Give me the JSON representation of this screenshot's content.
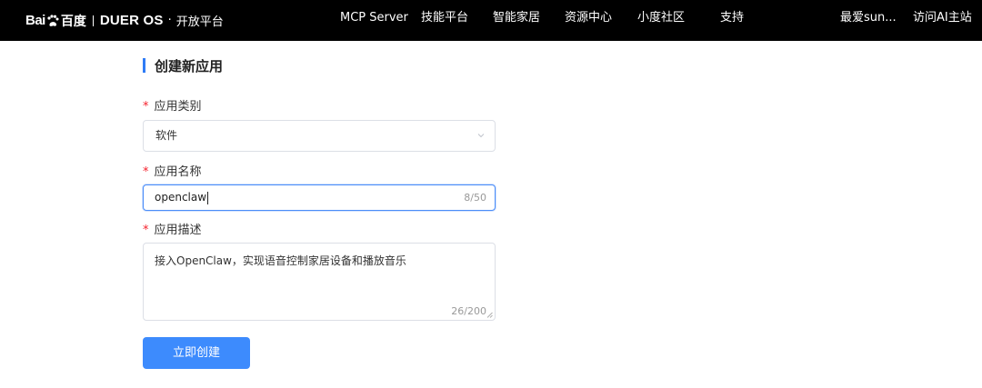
{
  "header": {
    "logo": {
      "brand_text": "Bai",
      "brand_cn": "百度",
      "product": "DUER",
      "product_os": "OS",
      "dot": "·",
      "platform": "开放平台"
    },
    "nav": [
      {
        "label": "MCP Server"
      },
      {
        "label": "技能平台"
      },
      {
        "label": "智能家居"
      },
      {
        "label": "资源中心"
      },
      {
        "label": "小度社区"
      },
      {
        "label": "支持"
      }
    ],
    "user_name": "最爱sun...",
    "visit_link": "访问AI主站"
  },
  "page_title": "创建新应用",
  "form": {
    "required_mark": "*",
    "category": {
      "label": "应用类别",
      "value": "软件",
      "icon": "chevron-down-icon"
    },
    "name": {
      "label": "应用名称",
      "value": "openclaw",
      "counter": "8/50"
    },
    "description": {
      "label": "应用描述",
      "value": "接入OpenClaw，实现语音控制家居设备和播放音乐",
      "counter": "26/200"
    },
    "submit_label": "立即创建"
  },
  "colors": {
    "topbar": "#000000",
    "accent": "#3d8bfd",
    "required": "#f5222d"
  }
}
